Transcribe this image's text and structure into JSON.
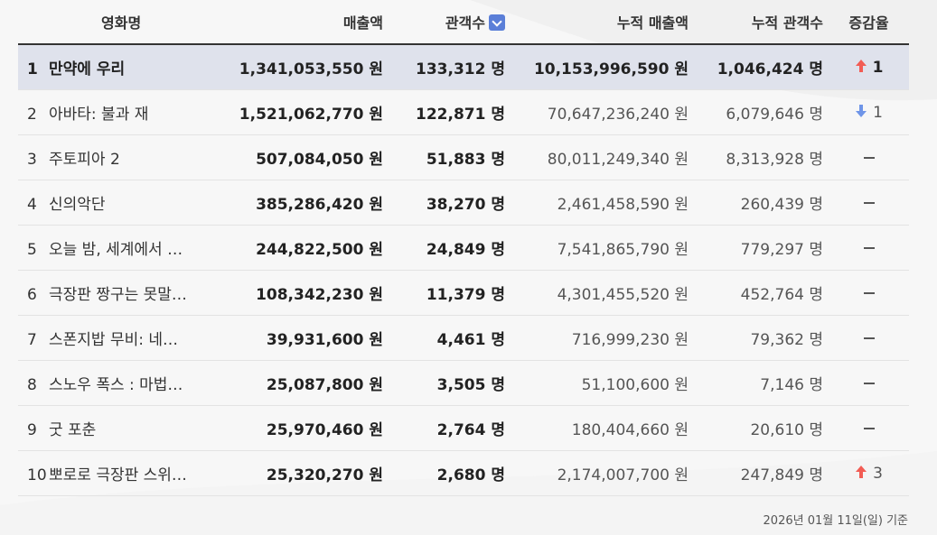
{
  "header": {
    "title": "영화명",
    "sales": "매출액",
    "audience": "관객수",
    "cum_sales": "누적 매출액",
    "cum_audience": "누적 관객수",
    "change": "증감율"
  },
  "rows": [
    {
      "rank": "1",
      "title": "만약에 우리",
      "sales": "1,341,053,550 원",
      "audience": "133,312 명",
      "cum_sales": "10,153,996,590 원",
      "cum_audience": "1,046,424 명",
      "change_dir": "up",
      "change": "1"
    },
    {
      "rank": "2",
      "title": "아바타: 불과 재",
      "sales": "1,521,062,770 원",
      "audience": "122,871 명",
      "cum_sales": "70,647,236,240 원",
      "cum_audience": "6,079,646 명",
      "change_dir": "down",
      "change": "1"
    },
    {
      "rank": "3",
      "title": "주토피아 2",
      "sales": "507,084,050 원",
      "audience": "51,883 명",
      "cum_sales": "80,011,249,340 원",
      "cum_audience": "8,313,928 명",
      "change_dir": "none",
      "change": ""
    },
    {
      "rank": "4",
      "title": "신의악단",
      "sales": "385,286,420 원",
      "audience": "38,270 명",
      "cum_sales": "2,461,458,590 원",
      "cum_audience": "260,439 명",
      "change_dir": "none",
      "change": ""
    },
    {
      "rank": "5",
      "title": "오늘 밤, 세계에서 …",
      "sales": "244,822,500 원",
      "audience": "24,849 명",
      "cum_sales": "7,541,865,790 원",
      "cum_audience": "779,297 명",
      "change_dir": "none",
      "change": ""
    },
    {
      "rank": "6",
      "title": "극장판 짱구는 못말…",
      "sales": "108,342,230 원",
      "audience": "11,379 명",
      "cum_sales": "4,301,455,520 원",
      "cum_audience": "452,764 명",
      "change_dir": "none",
      "change": ""
    },
    {
      "rank": "7",
      "title": "스폰지밥 무비: 네…",
      "sales": "39,931,600 원",
      "audience": "4,461 명",
      "cum_sales": "716,999,230 원",
      "cum_audience": "79,362 명",
      "change_dir": "none",
      "change": ""
    },
    {
      "rank": "8",
      "title": "스노우 폭스 : 마법…",
      "sales": "25,087,800 원",
      "audience": "3,505 명",
      "cum_sales": "51,100,600 원",
      "cum_audience": "7,146 명",
      "change_dir": "none",
      "change": ""
    },
    {
      "rank": "9",
      "title": "굿 포춘",
      "sales": "25,970,460 원",
      "audience": "2,764 명",
      "cum_sales": "180,404,660 원",
      "cum_audience": "20,610 명",
      "change_dir": "none",
      "change": ""
    },
    {
      "rank": "10",
      "title": "뽀로로 극장판 스위…",
      "sales": "25,320,270 원",
      "audience": "2,680 명",
      "cum_sales": "2,174,007,700 원",
      "cum_audience": "247,849 명",
      "change_dir": "up",
      "change": "3"
    }
  ],
  "footer": "2026년 01월 11일(일) 기준",
  "colors": {
    "up": "#f25c54",
    "down": "#6f95e8",
    "sort_button": "#5b7fd8"
  },
  "icons": {
    "sort": "chevron-down-icon",
    "up": "arrow-up-icon",
    "down": "arrow-down-icon",
    "none": "dash-icon"
  }
}
